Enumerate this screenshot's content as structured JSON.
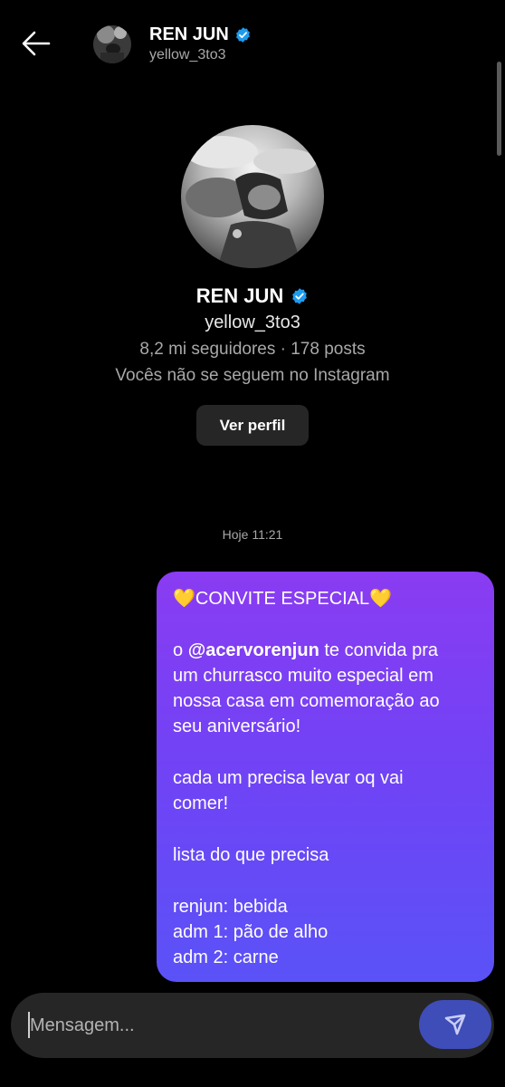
{
  "header": {
    "back_icon": "arrow-left-icon",
    "name": "REN JUN",
    "username": "yellow_3to3",
    "verified_icon": "verified-badge-icon"
  },
  "profile": {
    "name": "REN JUN",
    "username": "yellow_3to3",
    "stats": "8,2 mi seguidores · 178 posts",
    "follow_status": "Vocês não se seguem no Instagram",
    "view_profile_button": "Ver perfil"
  },
  "chat": {
    "timestamp": "Hoje 11:21",
    "message": {
      "l1": "💛CONVITE ESPECIAL💛",
      "l2_prefix": "o ",
      "l2_mention": "@acervorenjun",
      "l2_suffix": " te convida pra",
      "l3": "um churrasco muito especial em",
      "l4": "nossa casa em comemoração ao",
      "l5": "seu aniversário!",
      "l6": "cada um precisa levar oq vai",
      "l7": "comer!",
      "l8": "lista do que precisa",
      "l9": "renjun: bebida",
      "l10": "adm 1: pão de alho",
      "l11": "adm 2: carne"
    }
  },
  "composer": {
    "placeholder": "Mensagem...",
    "send_icon": "send-paper-plane-icon"
  },
  "colors": {
    "background": "#000000",
    "bubble_top": "#8a3cf2",
    "bubble_bottom": "#5a52f7",
    "verified": "#1d9bf0",
    "send_button": "#3f4db8"
  }
}
